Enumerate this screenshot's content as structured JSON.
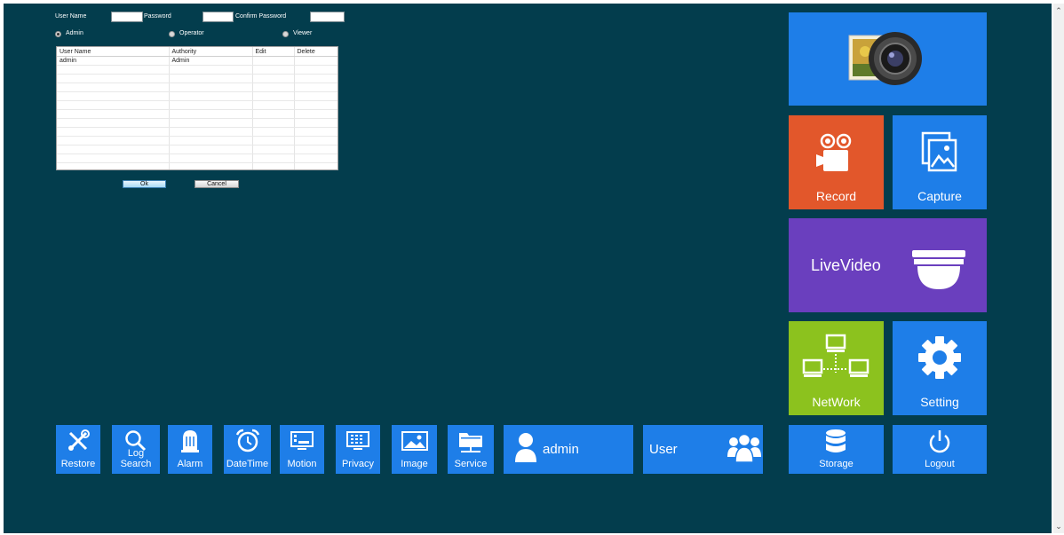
{
  "form": {
    "user_name_label": "User Name",
    "password_label": "Password",
    "confirm_password_label": "Confirm Password",
    "user_name_value": "",
    "password_value": "",
    "confirm_password_value": "",
    "roles": [
      {
        "label": "Admin",
        "selected": true
      },
      {
        "label": "Operator",
        "selected": false
      },
      {
        "label": "Viewer",
        "selected": false
      }
    ],
    "ok_label": "Ok",
    "cancel_label": "Cancel"
  },
  "user_table": {
    "columns": [
      "User Name",
      "Authority",
      "Edit",
      "Delete"
    ],
    "rows": [
      [
        "admin",
        "Admin",
        "",
        ""
      ]
    ]
  },
  "tiles": {
    "camera_icon": "camera-photo-icon",
    "record": "Record",
    "capture": "Capture",
    "livevideo": "LiveVideo",
    "network": "NetWork",
    "setting": "Setting",
    "storage": "Storage",
    "logout": "Logout"
  },
  "toolbar": {
    "items": [
      "Restore",
      "Log Search",
      "Alarm",
      "DateTime",
      "Motion",
      "Privacy",
      "Image",
      "Service"
    ],
    "current_user": "admin",
    "user_label": "User"
  },
  "colors": {
    "background": "#033d4d",
    "tile_blue": "#1e7ee8",
    "record_orange": "#e2572b",
    "livevideo_purple": "#6a3fbe",
    "network_green": "#8cc21e"
  }
}
